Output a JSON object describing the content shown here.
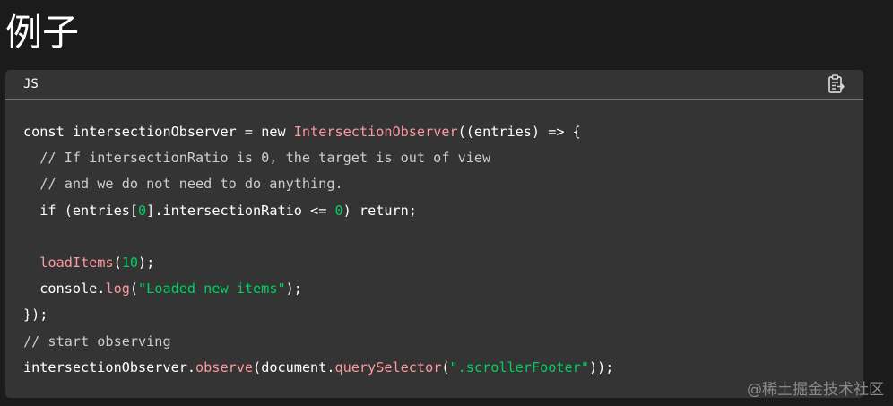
{
  "page": {
    "heading": "例子"
  },
  "code_block": {
    "language": "JS",
    "copy_icon": "clipboard-copy-icon",
    "lines": [
      [
        {
          "t": "const ",
          "c": "plain"
        },
        {
          "t": "intersectionObserver",
          "c": "plain"
        },
        {
          "t": " = ",
          "c": "plain"
        },
        {
          "t": "new ",
          "c": "plain"
        },
        {
          "t": "IntersectionObserver",
          "c": "cls"
        },
        {
          "t": "((entries) => {",
          "c": "plain"
        }
      ],
      [
        {
          "t": "  // If intersectionRatio is 0, the target is out of view",
          "c": "com"
        }
      ],
      [
        {
          "t": "  // and we do not need to do anything.",
          "c": "com"
        }
      ],
      [
        {
          "t": "  if (entries[",
          "c": "plain"
        },
        {
          "t": "0",
          "c": "num"
        },
        {
          "t": "].intersectionRatio <= ",
          "c": "plain"
        },
        {
          "t": "0",
          "c": "num"
        },
        {
          "t": ") return;",
          "c": "plain"
        }
      ],
      [],
      [
        {
          "t": "  ",
          "c": "plain"
        },
        {
          "t": "loadItems",
          "c": "fn"
        },
        {
          "t": "(",
          "c": "plain"
        },
        {
          "t": "10",
          "c": "num"
        },
        {
          "t": ");",
          "c": "plain"
        }
      ],
      [
        {
          "t": "  console.",
          "c": "plain"
        },
        {
          "t": "log",
          "c": "fn"
        },
        {
          "t": "(",
          "c": "plain"
        },
        {
          "t": "\"Loaded new items\"",
          "c": "str"
        },
        {
          "t": ");",
          "c": "plain"
        }
      ],
      [
        {
          "t": "});",
          "c": "plain"
        }
      ],
      [
        {
          "t": "// start observing",
          "c": "com"
        }
      ],
      [
        {
          "t": "intersectionObserver.",
          "c": "plain"
        },
        {
          "t": "observe",
          "c": "fn"
        },
        {
          "t": "(document.",
          "c": "plain"
        },
        {
          "t": "querySelector",
          "c": "fn"
        },
        {
          "t": "(",
          "c": "plain"
        },
        {
          "t": "\".scrollerFooter\"",
          "c": "str"
        },
        {
          "t": "));",
          "c": "plain"
        }
      ]
    ]
  },
  "watermark": {
    "text": "@稀土掘金技术社区"
  },
  "colors": {
    "page_background": "#1b1b1b",
    "code_background": "#343434",
    "divider": "#737373",
    "keyword_function": "#ff97a0",
    "number_string": "#00d061",
    "comment": "#cdcdcd",
    "plain_text": "#ffffff"
  }
}
